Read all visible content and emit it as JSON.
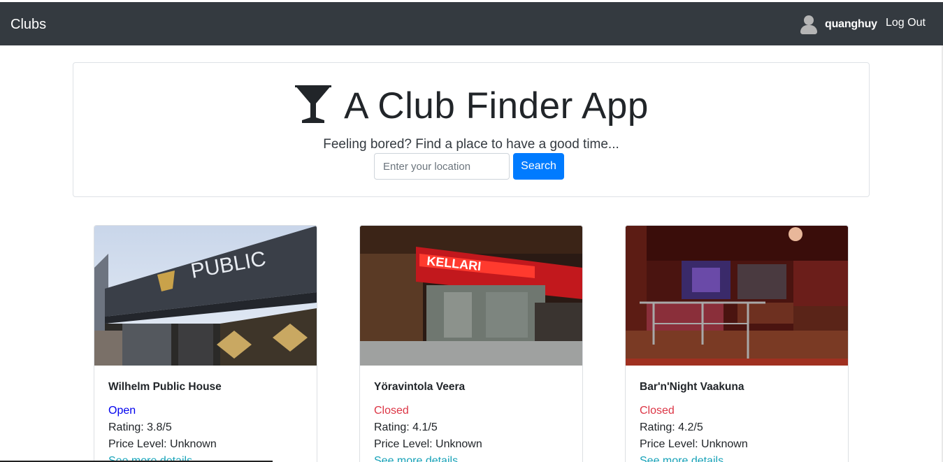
{
  "navbar": {
    "brand": "Clubs",
    "username": "quanghuy",
    "logout_label": "Log Out"
  },
  "hero": {
    "title": "A Club Finder App",
    "subtitle": "Feeling bored? Find a place to have a good time...",
    "search_placeholder": "Enter your location",
    "search_value": "",
    "search_button": "Search"
  },
  "clubs": [
    {
      "name": "Wilhelm Public House",
      "status": "Open",
      "rating": "Rating: 3.8/5",
      "price": "Price Level: Unknown",
      "link": "See more details"
    },
    {
      "name": "Yöravintola Veera",
      "status": "Closed",
      "rating": "Rating: 4.1/5",
      "price": "Price Level: Unknown",
      "link": "See more details"
    },
    {
      "name": "Bar'n'Night Vaakuna",
      "status": "Closed",
      "rating": "Rating: 4.2/5",
      "price": "Price Level: Unknown",
      "link": "See more details"
    }
  ],
  "colors": {
    "navbar_bg": "#343a40",
    "primary": "#007bff",
    "open": "#0000ee",
    "closed": "#dc3545",
    "link": "#17a2b8"
  },
  "icons": {
    "hero": "cocktail-glass-icon",
    "user": "user-avatar-icon"
  }
}
